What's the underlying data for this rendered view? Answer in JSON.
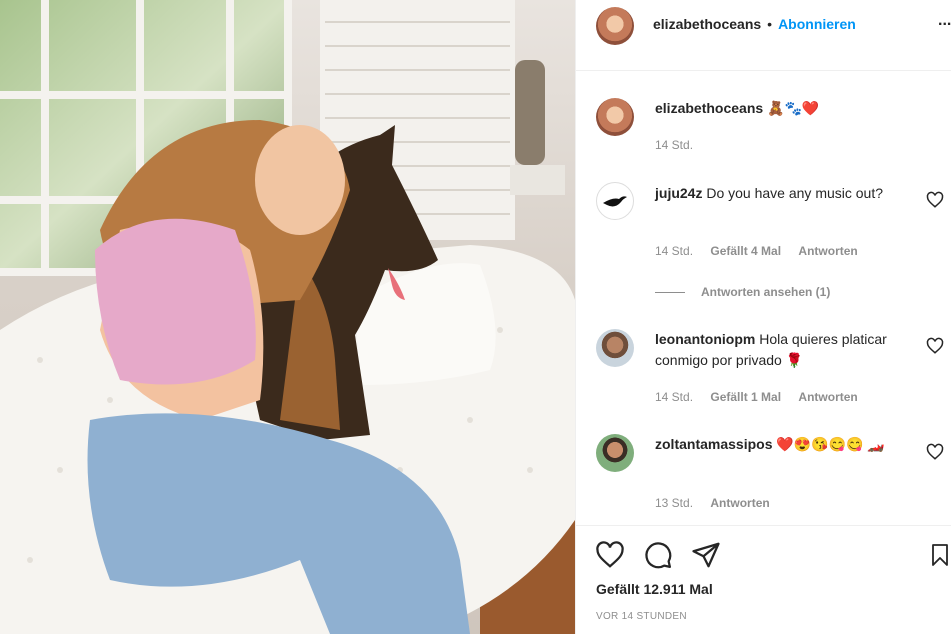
{
  "header": {
    "username": "elizabethoceans",
    "separator": "•",
    "follow_label": "Abonnieren",
    "more_label": "..."
  },
  "caption": {
    "username": "elizabethoceans",
    "emojis": "🧸🐾❤️",
    "time": "14 Std."
  },
  "comments": [
    {
      "username": "juju24z",
      "text": "Do you have any music out?",
      "time": "14 Std.",
      "likes": "Gefällt 4 Mal",
      "reply": "Antworten",
      "view_replies": "Antworten ansehen (1)"
    },
    {
      "username": "leonantoniopm",
      "text": "Hola quieres platicar conmigo por privado 🌹",
      "time": "14 Std.",
      "likes": "Gefällt 1 Mal",
      "reply": "Antworten"
    },
    {
      "username": "zoltantamassipos",
      "text": "❤️😍😘😋😋 🏎️",
      "time": "13 Std.",
      "reply": "Antworten"
    }
  ],
  "footer": {
    "likes": "Gefällt 12.911 Mal",
    "date": "VOR 14 STUNDEN"
  },
  "icons": {
    "like": "heart-icon",
    "comment": "comment-icon",
    "share": "share-icon",
    "save": "bookmark-icon",
    "more": "more-icon"
  },
  "colors": {
    "accent": "#0095f6",
    "text": "#262626",
    "muted": "#8e8e8e"
  }
}
